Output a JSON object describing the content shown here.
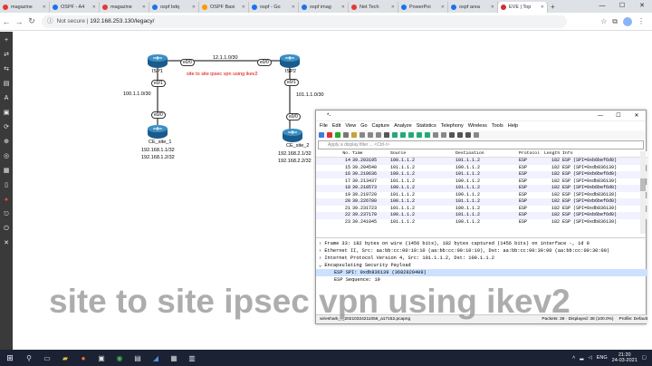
{
  "browser": {
    "tabs": [
      {
        "label": "magazine",
        "color": "#e53935"
      },
      {
        "label": "OSPF - A4",
        "color": "#1a73e8"
      },
      {
        "label": "magazine",
        "color": "#e53935"
      },
      {
        "label": "ospf bdq",
        "color": "#1a73e8"
      },
      {
        "label": "OSPF Basi",
        "color": "#ff9800"
      },
      {
        "label": "ospf - Go",
        "color": "#1a73e8"
      },
      {
        "label": "ospf imag",
        "color": "#1a73e8"
      },
      {
        "label": "Net Tech",
        "color": "#e53935"
      },
      {
        "label": "PowerPoi",
        "color": "#1a73e8"
      },
      {
        "label": "ospf area",
        "color": "#1a73e8"
      },
      {
        "label": "EVE | Top",
        "color": "#d32f2f",
        "active": true
      }
    ],
    "new_tab": "+",
    "security_label": "Not secure",
    "url": "192.168.253.130/legacy/"
  },
  "topology": {
    "isp1": "ISP1",
    "isp2": "ISP2",
    "ce1": "CE_site_1",
    "ce2": "CE_site_2",
    "link_isp": "12.1.1.0/30",
    "link_left": "100.1.1.0/30",
    "link_right": "101.1.1.0/30",
    "vpn_label": "site to site ipsec vpn using ikev2",
    "isp1_e00": "e0/0",
    "isp1_e01": "e0/1",
    "isp2_e00": "e0/0",
    "isp2_e01": "e0/1",
    "ce1_e00": "e0/0",
    "ce2_e00": "e0/0",
    "ce1_ip1": "192.168.1.1/32",
    "ce1_ip2": "192.168.1.2/32",
    "ce2_ip1": "192.168.2.1/32",
    "ce2_ip2": "192.168.2.2/32"
  },
  "wireshark": {
    "title": "*-",
    "menu": [
      "File",
      "Edit",
      "View",
      "Go",
      "Capture",
      "Analyze",
      "Statistics",
      "Telephony",
      "Wireless",
      "Tools",
      "Help"
    ],
    "filter_placeholder": "Apply a display filter ... <Ctrl-/>",
    "columns": [
      "No.",
      "Time",
      "Source",
      "Destination",
      "Protocol",
      "Length",
      "Info"
    ],
    "packets": [
      [
        "14",
        "39.203195",
        "100.1.1.2",
        "101.1.1.2",
        "ESP",
        "182",
        "ESP (SPI=0xb6bef6d0)"
      ],
      [
        "15",
        "39.204540",
        "101.1.1.2",
        "100.1.1.2",
        "ESP",
        "182",
        "ESP (SPI=0xdb836139)"
      ],
      [
        "16",
        "39.210636",
        "100.1.1.2",
        "101.1.1.2",
        "ESP",
        "182",
        "ESP (SPI=0xb6bef6d0)"
      ],
      [
        "17",
        "39.213437",
        "101.1.1.2",
        "100.1.1.2",
        "ESP",
        "182",
        "ESP (SPI=0xdb836139)"
      ],
      [
        "18",
        "39.218573",
        "100.1.1.2",
        "101.1.1.2",
        "ESP",
        "182",
        "ESP (SPI=0xb6bef6d0)"
      ],
      [
        "19",
        "39.219720",
        "101.1.1.2",
        "100.1.1.2",
        "ESP",
        "182",
        "ESP (SPI=0xdb836139)"
      ],
      [
        "20",
        "39.226780",
        "100.1.1.2",
        "101.1.1.2",
        "ESP",
        "182",
        "ESP (SPI=0xb6bef6d0)"
      ],
      [
        "21",
        "39.231723",
        "101.1.1.2",
        "100.1.1.2",
        "ESP",
        "182",
        "ESP (SPI=0xdb836139)"
      ],
      [
        "22",
        "39.237170",
        "100.1.1.2",
        "101.1.1.2",
        "ESP",
        "182",
        "ESP (SPI=0xb6bef6d0)"
      ],
      [
        "23",
        "39.241045",
        "101.1.1.2",
        "100.1.1.2",
        "ESP",
        "182",
        "ESP (SPI=0xdb836139)"
      ]
    ],
    "details": [
      "Frame 33: 182 bytes on wire (1456 bits), 182 bytes captured (1456 bits) on interface -, id 0",
      "Ethernet II, Src: aa:bb:cc:00:10:10 (aa:bb:cc:00:10:10), Dst: aa:bb:cc:00:30:00 (aa:bb:cc:00:30:00)",
      "Internet Protocol Version 4, Src: 101.1.1.2, Dst: 100.1.1.2",
      "Encapsulating Security Payload"
    ],
    "detail_sub": [
      "ESP SPI: 0xdb836139 (3682820409)",
      "ESP Sequence: 19"
    ],
    "status_file": "wireshark_-_20210324211056_a17152.pcapng",
    "status_packets": "Packets: 38 · Displayed: 38 (100.0%)",
    "status_profile": "Profile: Default"
  },
  "overlay_caption": "site to site ipsec vpn using ikev2",
  "taskbar": {
    "lang": "ENG",
    "time": "21:20",
    "date": "24-03-2021"
  }
}
